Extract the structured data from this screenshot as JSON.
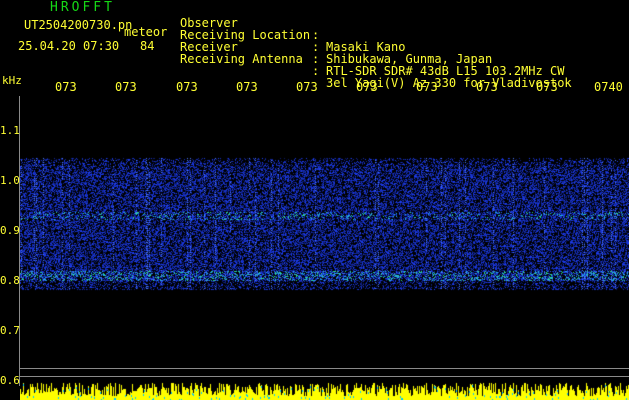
{
  "header": {
    "app_title": "HROFFT",
    "file_name": "UT2504200730.pn",
    "category": "meteor",
    "date_time": "25.04.20 07:30",
    "count": "84"
  },
  "meta": [
    {
      "label": "Observer",
      "sep": ":",
      "value": "Masaki Kano"
    },
    {
      "label": "Receiving Location",
      "sep": ":",
      "value": "Shibukawa, Gunma, Japan"
    },
    {
      "label": "Receiver",
      "sep": ":",
      "value": "RTL-SDR SDR# 43dB L15 103.2MHz CW"
    },
    {
      "label": "Receiving Antenna",
      "sep": ":",
      "value": "3el Yagi(V) Az 330 for Vladivostok"
    }
  ],
  "axis": {
    "unit": "kHz",
    "time_ticks": [
      "073",
      "073",
      "073",
      "073",
      "073",
      "073",
      "073",
      "073",
      "073",
      "0740"
    ],
    "freq_ticks": [
      "1.1",
      "1.0",
      "0.9",
      "0.8",
      "0.7",
      "0.6"
    ]
  },
  "colors": {
    "background": "#000000",
    "text": "#ffff33",
    "title": "#16d916",
    "signal_low": "#1a2cff",
    "signal_high": "#2fe08a",
    "bottom_band": "#ffff00"
  }
}
